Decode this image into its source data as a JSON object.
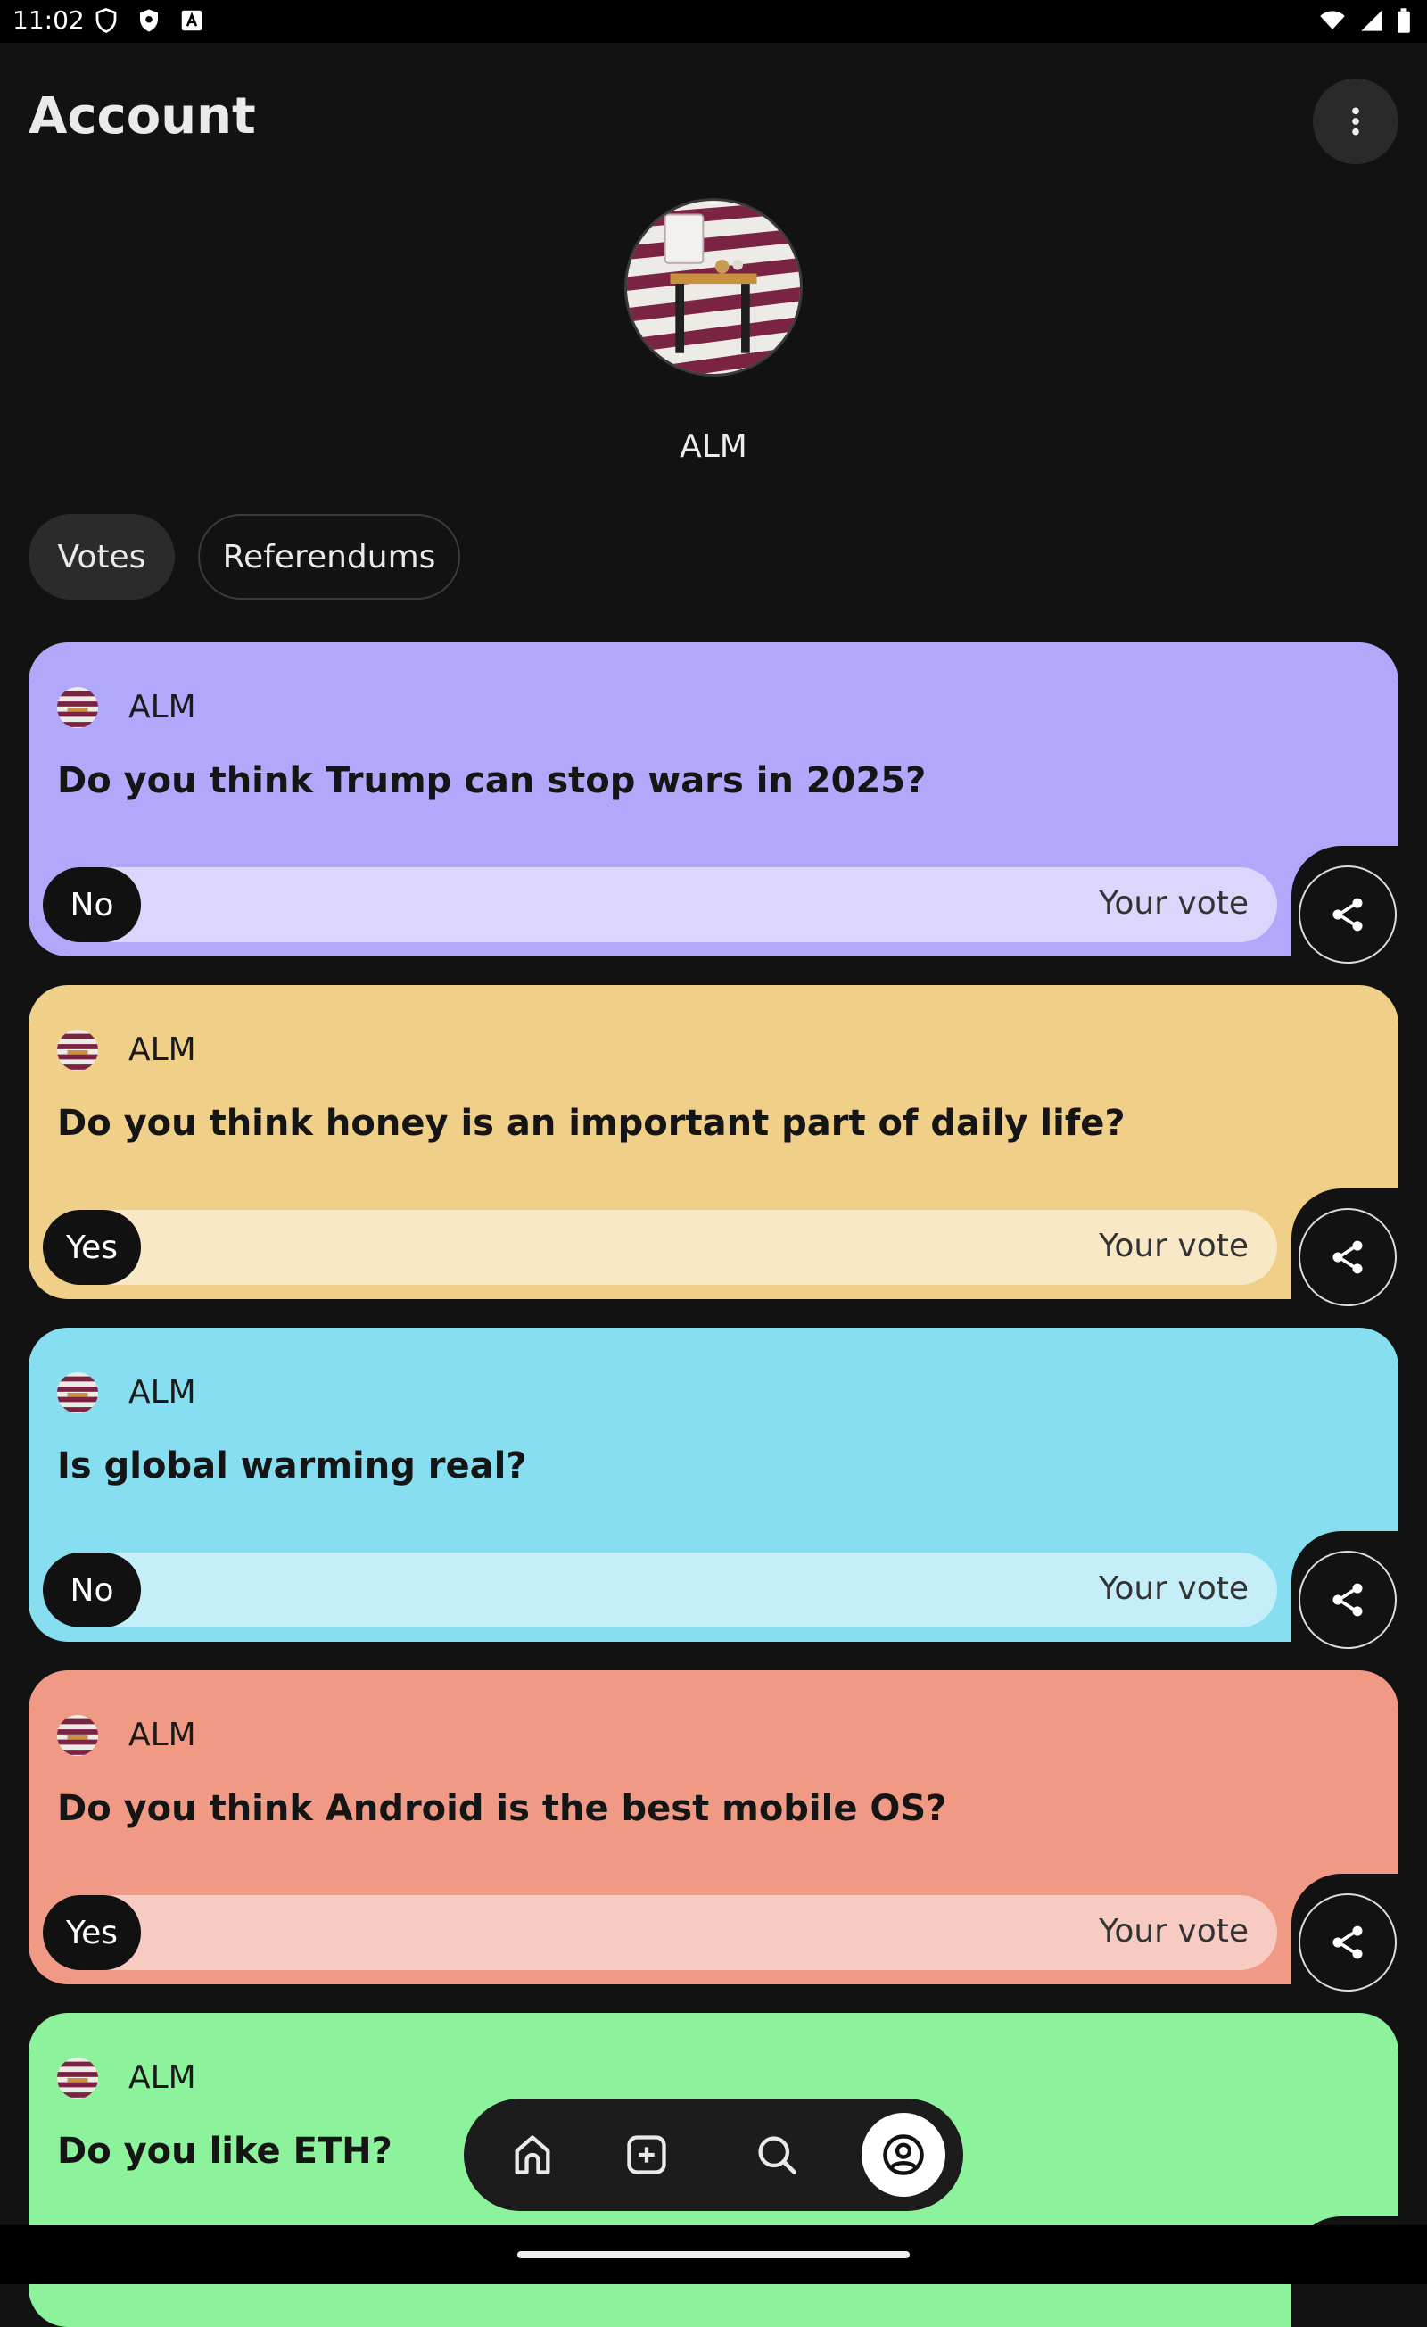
{
  "status_bar": {
    "time": "11:02"
  },
  "header": {
    "title": "Account"
  },
  "profile": {
    "name": "ALM"
  },
  "tabs": [
    {
      "label": "Votes",
      "active": true
    },
    {
      "label": "Referendums",
      "active": false
    }
  ],
  "cards": [
    {
      "author": "ALM",
      "question": "Do you think Trump can stop wars in 2025?",
      "choice": "No",
      "your_vote_label": "Your vote",
      "color": "#b1a8fb",
      "bar_color": "#dcd6fc"
    },
    {
      "author": "ALM",
      "question": "Do you think honey is an important part of daily life?",
      "choice": "Yes",
      "your_vote_label": "Your vote",
      "color": "#f0cf88",
      "bar_color": "#f8e8c6"
    },
    {
      "author": "ALM",
      "question": "Is global warming real?",
      "choice": "No",
      "your_vote_label": "Your vote",
      "color": "#88def1",
      "bar_color": "#c4eff8"
    },
    {
      "author": "ALM",
      "question": "Do you think Android is the best mobile OS?",
      "choice": "Yes",
      "your_vote_label": "Your vote",
      "color": "#f09a86",
      "bar_color": "#f8cbc2"
    },
    {
      "author": "ALM",
      "question": "Do you like ETH?",
      "choice": "",
      "your_vote_label": "",
      "color": "#8cf29c",
      "bar_color": "#c8f8d0"
    }
  ],
  "bottom_nav": {
    "items": [
      {
        "icon": "home-icon",
        "active": false
      },
      {
        "icon": "add-icon",
        "active": false
      },
      {
        "icon": "search-icon",
        "active": false
      },
      {
        "icon": "account-icon",
        "active": true
      }
    ]
  }
}
